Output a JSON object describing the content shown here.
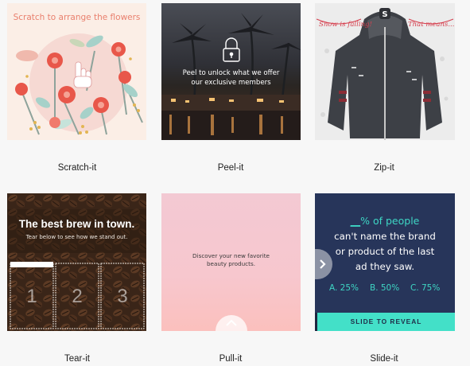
{
  "cards": [
    {
      "label": "Scratch-it",
      "title": "Scratch to arrange the flowers"
    },
    {
      "label": "Peel-it",
      "message_line1": "Peel to unlock what we offer",
      "message_line2": "our exclusive members"
    },
    {
      "label": "Zip-it",
      "banner_left": "Snow is falling!",
      "banner_right": "That means..."
    },
    {
      "label": "Tear-it",
      "headline": "The best brew in town.",
      "subline": "Tear below to see how we stand out.",
      "strips": [
        "1",
        "2",
        "3"
      ]
    },
    {
      "label": "Pull-it",
      "message_line1": "Discover your new favorite",
      "message_line2": "beauty products."
    },
    {
      "label": "Slide-it",
      "q_blank": "__",
      "q_part1": "% of people",
      "q_line2": "can't name the brand",
      "q_line3": "or product of the last",
      "q_line4": "ad they saw.",
      "options": [
        "A. 25%",
        "B. 50%",
        "C. 75%"
      ],
      "cta": "SLIDE TO REVEAL"
    }
  ],
  "colors": {
    "scratch_title": "#e9806e",
    "slide_bg": "#27355a",
    "slide_accent": "#3ed6c4",
    "slide_cta": "#43e0c8"
  }
}
